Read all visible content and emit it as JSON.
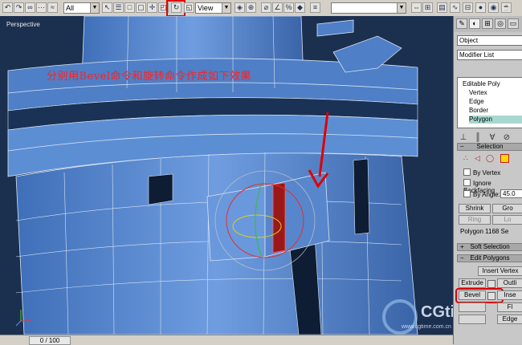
{
  "toolbar": {
    "filter_value": "All",
    "coord_value": "View",
    "named_selection_value": "",
    "icons": [
      "undo-icon",
      "redo-icon",
      "link-icon",
      "unlink-icon",
      "bind-space-warp-icon",
      "select-object-icon",
      "select-by-name-icon",
      "select-region-icon",
      "select-move-icon",
      "select-rotate-icon",
      "select-scale-icon",
      "pivot-center-icon",
      "manipulate-icon",
      "snaps-toggle-icon",
      "angle-snap-icon",
      "percent-snap-icon",
      "spinner-snap-icon",
      "mirror-icon",
      "align-icon"
    ]
  },
  "viewport": {
    "label": "Perspective",
    "overlay_text": "分别用Bevel命令和旋转命令作成如下效果",
    "frame_counter": "0 / 100"
  },
  "command_panel": {
    "name_field": "Object",
    "modifier_list": "Modifier List",
    "stack": [
      {
        "label": "Editable Poly",
        "selected": false,
        "indent": 0
      },
      {
        "label": "Vertex",
        "selected": false,
        "indent": 1
      },
      {
        "label": "Edge",
        "selected": false,
        "indent": 1
      },
      {
        "label": "Border",
        "selected": false,
        "indent": 1
      },
      {
        "label": "Polygon",
        "selected": true,
        "indent": 1
      }
    ],
    "selection_rollout": {
      "title": "Selection",
      "by_vertex": "By Vertex",
      "ignore_backfacing": "Ignore Backfacing",
      "by_angle": "By Angle:",
      "angle_value": "45.0",
      "shrink": "Shrink",
      "grow": "Gro",
      "ring": "Ring",
      "loop": "Lo",
      "status": "Polygon 1168 Se"
    },
    "soft_selection": "Soft Selection",
    "edit_polygons": {
      "title": "Edit Polygons",
      "insert_vertex": "Insert Vertex",
      "extrude": "Extrude",
      "outline": "Outli",
      "bevel": "Bevel",
      "inset": "Inse",
      "row3_right": "Fl",
      "row4_right": "Edge"
    }
  },
  "watermark": {
    "brand": "CGtime",
    "url": "www.cgtime.com.cn"
  },
  "colors": {
    "model_fill": "#5f8fd4",
    "viewport_bg": "#1f3a5e",
    "annotation": "#e00000",
    "selected_poly": "#9a1818"
  }
}
